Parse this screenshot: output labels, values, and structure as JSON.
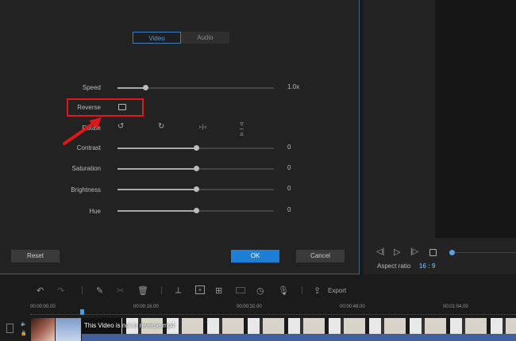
{
  "tabs": {
    "video": "Video",
    "audio": "Audio"
  },
  "settings": {
    "speed": {
      "label": "Speed",
      "value": "1.0x",
      "fraction": 0.18
    },
    "reverse": {
      "label": "Reverse",
      "checked": false
    },
    "rotate": {
      "label": "Rotate"
    },
    "contrast": {
      "label": "Contrast",
      "value": "0",
      "fraction": 0.5
    },
    "saturation": {
      "label": "Saturation",
      "value": "0",
      "fraction": 0.5
    },
    "brightness": {
      "label": "Brightness",
      "value": "0",
      "fraction": 0.5
    },
    "hue": {
      "label": "Hue",
      "value": "0",
      "fraction": 0.5
    }
  },
  "buttons": {
    "reset": "Reset",
    "ok": "OK",
    "cancel": "Cancel"
  },
  "player": {
    "aspect_label": "Aspect ratio",
    "aspect_value": "16 : 9"
  },
  "toolbar": {
    "export": "Export"
  },
  "timeline": {
    "ticks": [
      "00:00:00.00",
      "00:00:16.00",
      "00:00:32.00",
      "00:00:48.00",
      "00:01:04.00"
    ],
    "clip_name": "This Video is not in reverse.mp4"
  },
  "colors": {
    "accent": "#1e7fd6",
    "highlight": "#e0161b"
  }
}
